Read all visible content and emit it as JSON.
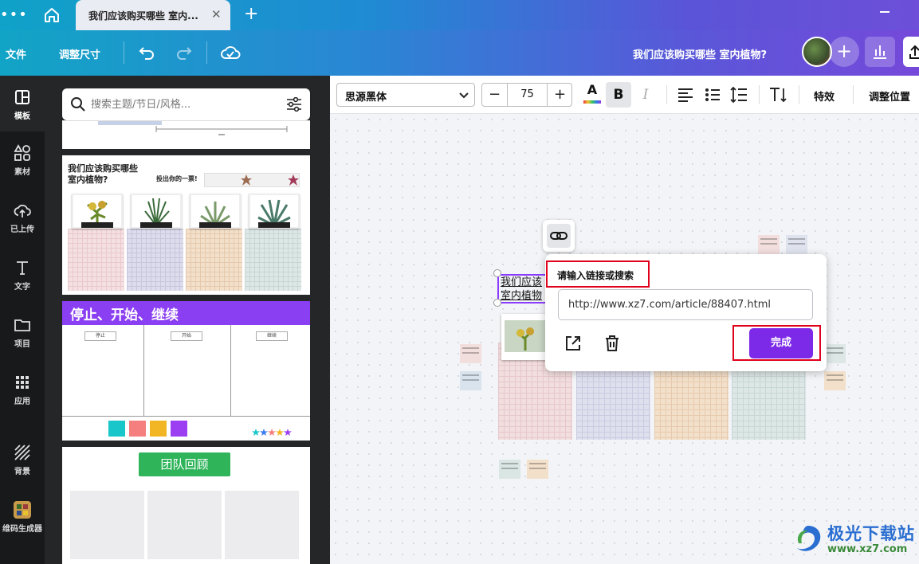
{
  "tabbar": {
    "menu_dots": "•••",
    "tab_title": "我们应该购买哪些 室内...",
    "tab_close": "✕",
    "new_tab": "+"
  },
  "header": {
    "file": "文件",
    "resize": "调整尺寸",
    "doc_title": "我们应该购买哪些 室内植物?",
    "add": "+"
  },
  "rail": [
    {
      "label": "模板",
      "icon": "template-icon",
      "active": true
    },
    {
      "label": "素材",
      "icon": "elements-icon"
    },
    {
      "label": "已上传",
      "icon": "upload-cloud-icon"
    },
    {
      "label": "文字",
      "icon": "text-icon"
    },
    {
      "label": "项目",
      "icon": "folder-icon"
    },
    {
      "label": "应用",
      "icon": "apps-grid-icon"
    },
    {
      "label": "背景",
      "icon": "background-stripes-icon"
    },
    {
      "label": "维码生成器",
      "icon": "qr-generator-app-icon"
    }
  ],
  "panel": {
    "search_placeholder": "搜索主题/节日/风格...",
    "template2": {
      "title": "我们应该购买哪些 室内植物?",
      "vote": "投出你的一票!"
    },
    "template3": {
      "title": "停止、开始、继续",
      "col_stop": "停止",
      "col_start": "开始",
      "col_continue": "继续"
    },
    "template4": {
      "title": "团队回顾"
    },
    "collapse": "‹"
  },
  "toolbar": {
    "font": "思源黑体",
    "font_size": "75",
    "minus": "−",
    "plus": "+",
    "color_letter": "A",
    "bold": "B",
    "italic": "I",
    "effects": "特效",
    "position": "调整位置"
  },
  "canvas": {
    "selected_text": "我们应该",
    "selected_text_2": "室内植物"
  },
  "link_popup": {
    "label": "请输入链接或搜索",
    "url": "http://www.xz7.com/article/88407.html",
    "done": "完成"
  },
  "watermark": {
    "brand": "极光下载站",
    "url": "www.xz7.com"
  },
  "colors": {
    "accent": "#7d2ae8",
    "highlight": "#e0001b",
    "rail_bg": "#18191b"
  }
}
